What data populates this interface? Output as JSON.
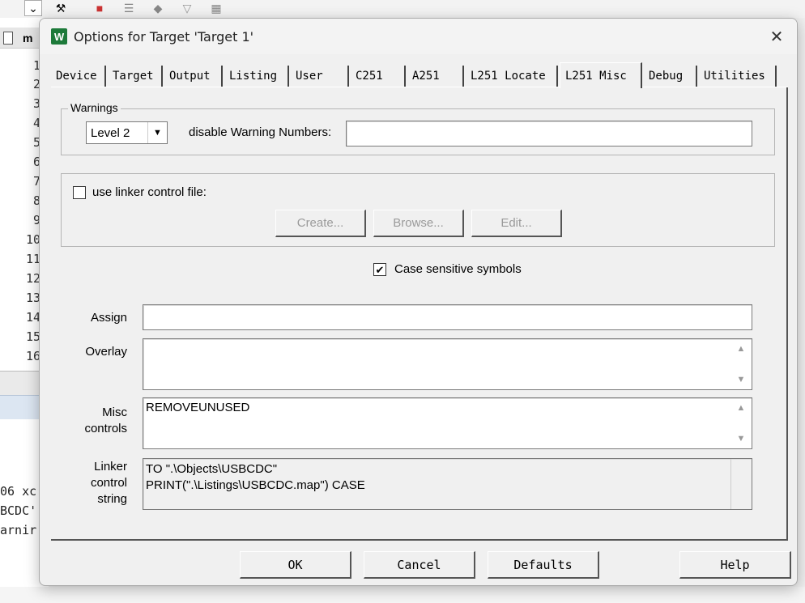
{
  "background": {
    "file_tab_label": "m",
    "line_numbers": [
      "1",
      "2",
      "3",
      "4",
      "5",
      "6",
      "7",
      "8",
      "9",
      "10",
      "11",
      "12",
      "13",
      "14",
      "15",
      "16"
    ],
    "output_lines": [
      "06 xc",
      "BCDC'",
      "arnir"
    ]
  },
  "dialog": {
    "title": "Options for Target 'Target 1'",
    "icon_letters": "W",
    "tabs": [
      "Device",
      "Target",
      "Output",
      "Listing",
      "User",
      "C251",
      "A251",
      "L251 Locate",
      "L251 Misc",
      "Debug",
      "Utilities"
    ],
    "active_tab": "L251 Misc",
    "warnings": {
      "group_label": "Warnings",
      "level_value": "Level 2",
      "disable_label": "disable Warning Numbers:",
      "disable_value": ""
    },
    "linker_control": {
      "checkbox_label": "use linker control file:",
      "checked": false,
      "create_label": "Create...",
      "browse_label": "Browse...",
      "edit_label": "Edit..."
    },
    "case_sensitive": {
      "label": "Case sensitive symbols",
      "checked": true
    },
    "assign": {
      "label": "Assign",
      "value": ""
    },
    "overlay": {
      "label": "Overlay",
      "value": ""
    },
    "misc": {
      "label_line1": "Misc",
      "label_line2": "controls",
      "value": "REMOVEUNUSED"
    },
    "linker_string": {
      "label_line1": "Linker",
      "label_line2": "control",
      "label_line3": "string",
      "line1": "TO \".\\Objects\\USBCDC\"",
      "line2": "PRINT(\".\\Listings\\USBCDC.map\") CASE"
    },
    "buttons": {
      "ok": "OK",
      "cancel": "Cancel",
      "defaults": "Defaults",
      "help": "Help"
    }
  }
}
